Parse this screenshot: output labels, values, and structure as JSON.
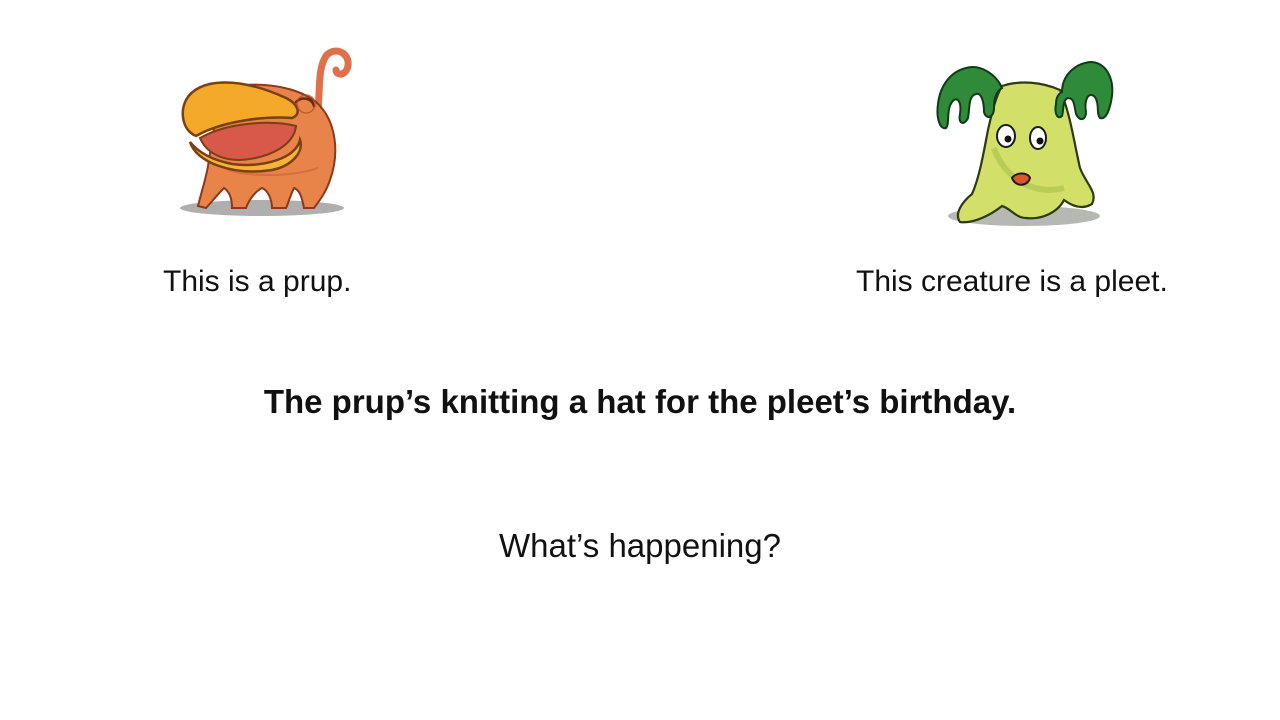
{
  "slide": {
    "left_caption": "This is a prup.",
    "right_caption": "This creature is a pleet.",
    "statement": "The prup’s knitting a hat for the pleet’s birthday.",
    "question": "What’s happening?"
  },
  "illustrations": {
    "prup": {
      "icon": "orange-duck-billed-creature-icon",
      "body_color": "#e8834a",
      "beak_color": "#f4a928"
    },
    "pleet": {
      "icon": "green-leafy-creature-icon",
      "body_color": "#d2e06a",
      "leaf_color": "#2f8a3a"
    }
  }
}
